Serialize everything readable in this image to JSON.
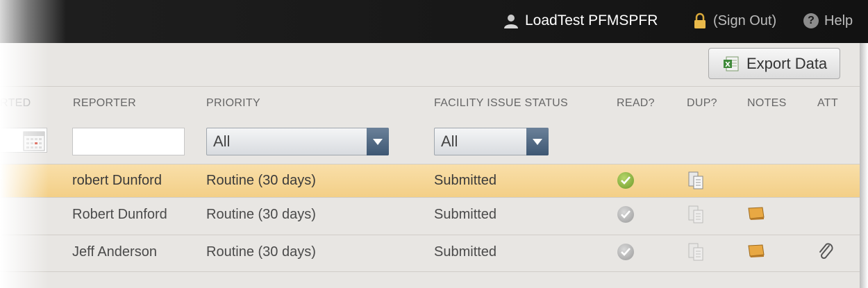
{
  "topbar": {
    "user_icon": "user-icon",
    "user_name": "LoadTest PFMSPFR",
    "lock_icon": "lock-icon",
    "sign_out": "(Sign Out)",
    "help_icon": "help-icon",
    "help_glyph": "?",
    "help": "Help"
  },
  "toolbar": {
    "export_icon": "excel-icon",
    "export_label": "Export Data"
  },
  "columns": {
    "reported": "RTED",
    "reporter": "REPORTER",
    "priority": "PRIORITY",
    "status": "FACILITY ISSUE STATUS",
    "read": "READ?",
    "dup": "DUP?",
    "notes": "NOTES",
    "att": "ATT"
  },
  "filters": {
    "reported_date": "",
    "reporter": "",
    "priority_selected": "All",
    "status_selected": "All"
  },
  "rows": [
    {
      "reporter": "robert Dunford",
      "priority": "Routine (30 days)",
      "status": "Submitted",
      "read": true,
      "has_dup": true,
      "has_notes": false,
      "has_attachment": false,
      "highlighted": true
    },
    {
      "reporter": "Robert Dunford",
      "priority": "Routine (30 days)",
      "status": "Submitted",
      "read": false,
      "has_dup": false,
      "has_notes": true,
      "has_attachment": false,
      "highlighted": false
    },
    {
      "reporter": "Jeff Anderson",
      "priority": "Routine (30 days)",
      "status": "Submitted",
      "read": false,
      "has_dup": false,
      "has_notes": true,
      "has_attachment": true,
      "highlighted": false
    }
  ],
  "colors": {
    "topbar": "#121212",
    "panel": "#e8e6e3",
    "highlight_row": "#f6d898",
    "select_arrow": "#4c637d",
    "read_check": "#7fa534"
  }
}
